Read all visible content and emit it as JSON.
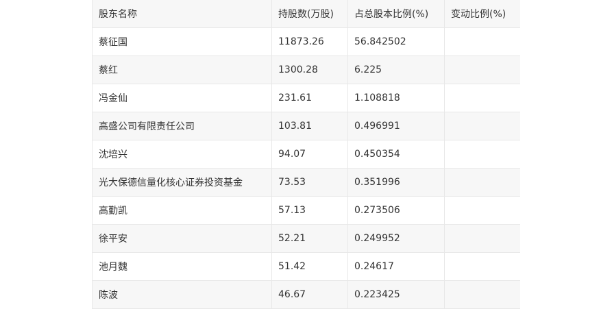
{
  "table": {
    "headers": [
      "股东名称",
      "持股数(万股)",
      "占总股本比例(%)",
      "变动比例(%)"
    ],
    "rows": [
      [
        "蔡征国",
        "11873.26",
        "56.842502",
        ""
      ],
      [
        "蔡红",
        "1300.28",
        "6.225",
        ""
      ],
      [
        "冯金仙",
        "231.61",
        "1.108818",
        ""
      ],
      [
        "高盛公司有限责任公司",
        "103.81",
        "0.496991",
        ""
      ],
      [
        "沈培兴",
        "94.07",
        "0.450354",
        ""
      ],
      [
        "光大保德信量化核心证券投资基金",
        "73.53",
        "0.351996",
        ""
      ],
      [
        "高勤凯",
        "57.13",
        "0.273506",
        ""
      ],
      [
        "徐平安",
        "52.21",
        "0.249952",
        ""
      ],
      [
        "池月魏",
        "51.42",
        "0.24617",
        ""
      ],
      [
        "陈波",
        "46.67",
        "0.223425",
        ""
      ]
    ]
  }
}
